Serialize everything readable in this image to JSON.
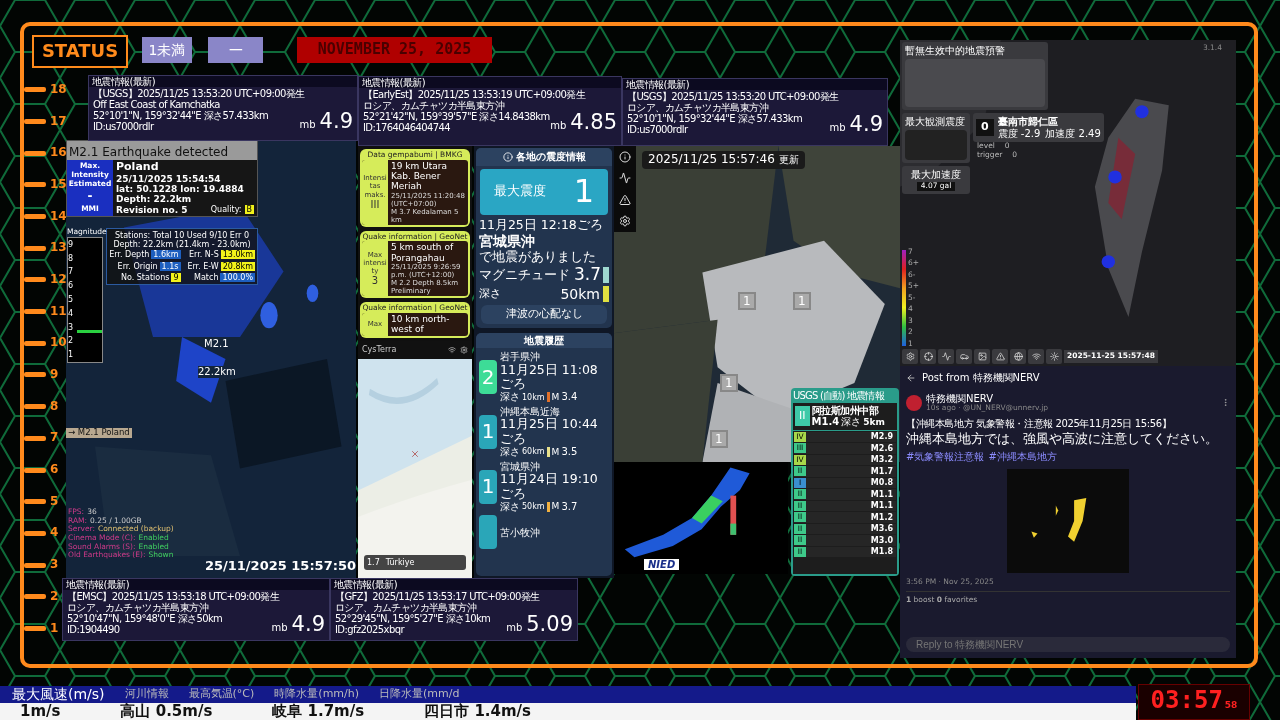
{
  "status": {
    "label": "STATUS",
    "intensity": "1未満",
    "level": "一",
    "date": "NOVEMBER 25, 2025"
  },
  "ruler": [
    "18",
    "17",
    "16",
    "15",
    "14",
    "13",
    "12",
    "11",
    "10",
    "9",
    "8",
    "7",
    "6",
    "5",
    "4",
    "3",
    "2",
    "1"
  ],
  "quake_cards": [
    {
      "header": "地震情報(最新)",
      "source": "【USGS】2025/11/25  13:53:20  UTC+09:00発生",
      "place": "Off East Coast of Kamchatka",
      "coords": "52°10'1\"N,  159°32'44\"E   深さ57.433km",
      "id": "ID:us7000rdlr",
      "unit": "mb",
      "magnitude": "4.9"
    },
    {
      "header": "地震情報(最新)",
      "source": "【EarlyEst】2025/11/25  13:53:19  UTC+09:00発生",
      "place": "ロシア、カムチャツカ半島東方沖",
      "coords": "52°21'42\"N,  159°39'57\"E   深さ14.8438km",
      "id": "ID:1764046404744",
      "unit": "mb",
      "magnitude": "4.85"
    },
    {
      "header": "地震情報(最新)",
      "source": "【USGS】2025/11/25  13:53:20  UTC+09:00発生",
      "place": "ロシア、カムチャツカ半島東方沖",
      "coords": "52°10'1\"N,  159°32'44\"E   深さ57.433km",
      "id": "ID:us7000rdlr",
      "unit": "mb",
      "magnitude": "4.9"
    },
    {
      "header": "地震情報(最新)",
      "source": "【EMSC】2025/11/25  13:53:18  UTC+09:00発生",
      "place": "ロシア、カムチャツカ半島東方沖",
      "coords": "52°10'47\"N,  159°48'0\"E   深さ50km",
      "id": "ID:1904490",
      "unit": "mb",
      "magnitude": "4.9"
    },
    {
      "header": "地震情報(最新)",
      "source": "【GFZ】2025/11/25  13:53:17  UTC+09:00発生",
      "place": "ロシア、カムチャツカ半島東方沖",
      "coords": "52°29'45\"N,  159°5'27\"E   深さ10km",
      "id": "ID:gfz2025xbqr",
      "unit": "mb",
      "magnitude": "5.09"
    }
  ],
  "globe": {
    "title": "M2.1 Earthquake detected",
    "intensity_box": [
      "Max. Intensity",
      "Estimated",
      "-",
      "MMI"
    ],
    "info": [
      "Poland",
      "25/11/2025 15:54:54",
      "lat: 50.1228 lon: 19.4884",
      "Depth: 22.2km",
      "Revision no. 5"
    ],
    "quality_label": "Quality:",
    "quality": "B",
    "stations": {
      "lines": [
        "Stations: Total 10 Used 9/10 Err 0",
        "Depth: 22.2km (21.4km - 23.0km)"
      ],
      "stats": [
        {
          "label": "Err. Depth",
          "value": "1.6km",
          "kind": "blue"
        },
        {
          "label": "Err. N-S",
          "value": "13.0km",
          "kind": "yellow"
        },
        {
          "label": "Err. Origin",
          "value": "1.1s",
          "kind": "blue"
        },
        {
          "label": "Err. E-W",
          "value": "20.8km",
          "kind": "yellow"
        },
        {
          "label": "No. Stations",
          "value": "9",
          "kind": "yellow"
        },
        {
          "label": "Match",
          "value": "100.0%",
          "kind": "blue"
        }
      ]
    },
    "magnitude_scale": {
      "label": "Magnitude",
      "ticks": [
        "9",
        "8",
        "7",
        "6",
        "5",
        "4",
        "3",
        "2",
        "1"
      ],
      "level": 0.23
    },
    "map_labels": [
      "M2.1",
      "22.2km"
    ],
    "tag": "→ M2.1 Poland",
    "diagnostics": [
      {
        "key": "FPS:",
        "value": "36"
      },
      {
        "key": "RAM:",
        "value": "0.25 / 1.00GB"
      },
      {
        "key": "Server:",
        "value": "Connected (backup)"
      },
      {
        "key": "Cinema Mode (C):",
        "value": "Enabled"
      },
      {
        "key": "Sound Alarms (S):",
        "value": "Enabled"
      },
      {
        "key": "Old Earthquakes (E):",
        "value": "Shown"
      }
    ],
    "timestamp": "25/11/2025 15:57:50"
  },
  "feed": {
    "cards": [
      {
        "header": "Data gempabumi | BMKG",
        "side": [
          "Intensitas maks.",
          "III"
        ],
        "title": "19 km Utara Kab. Bener Meriah",
        "meta": [
          "25/11/2025 11:20:48 (UTC+07:00)",
          "M 3.7   Kedalaman 5 km"
        ]
      },
      {
        "header": "Quake information | GeoNet",
        "side": [
          "Max intensity",
          "3"
        ],
        "title": "5 km south of Porangahau",
        "meta": [
          "25/11/2025 9:26:59 p.m. (UTC+12:00)",
          "M 2.2   Depth 8.5km   Preliminary"
        ]
      },
      {
        "header": "Quake information | GeoNet",
        "side": [
          "Max"
        ],
        "title": "10 km north-west of"
      }
    ],
    "app_name": "CysTerra",
    "map_card": {
      "magnitude": "1.7",
      "place": "Türkiye"
    }
  },
  "jma": {
    "header": "各地の震度情報",
    "max_label": "最大震度",
    "max_value": "1",
    "time": "11月25日 12:18ごろ",
    "place": "宮城県沖",
    "note": "で地震がありました",
    "magnitude_label": "マグニチュード",
    "magnitude": "3.7",
    "depth_label": "深さ",
    "depth": "50km",
    "tsunami": "津波の心配なし",
    "history_title": "地震履歴",
    "history": [
      {
        "intensity": "2",
        "color": "#3ddc97",
        "place": "岩手県沖",
        "time": "11月25日 11:08ごろ",
        "depth_label": "深さ",
        "depth": "10km",
        "depth_marker": {
          "color": "#e0702a"
        },
        "m": "M",
        "magnitude": "3.4"
      },
      {
        "intensity": "1",
        "color": "#2aa6b8",
        "place": "沖縄本島近海",
        "time": "11月25日 10:44ごろ",
        "depth_label": "深さ",
        "depth": "60km",
        "depth_marker": {
          "color": "#e8e08a"
        },
        "m": "M",
        "magnitude": "3.5"
      },
      {
        "intensity": "1",
        "color": "#2aa6b8",
        "place": "宮城県沖",
        "time": "11月24日 19:10ごろ",
        "depth_label": "深さ",
        "depth": "50km",
        "depth_marker": {
          "color": "#f0b040"
        },
        "m": "M",
        "magnitude": "3.7"
      },
      {
        "color": "#2aa6b8",
        "place": "苫小牧沖"
      }
    ]
  },
  "region_map": {
    "updated": "2025/11/25  15:57:46",
    "updated_label": "更新",
    "markers": [
      "1",
      "1",
      "1",
      "1"
    ]
  },
  "usgs": {
    "header": "USGS (自動) 地震情報",
    "top": {
      "intensity": "II",
      "place": "阿拉斯加州中部",
      "magnitude": "M1.4",
      "depth_label": "深さ",
      "depth": "5km"
    },
    "rows": [
      {
        "intensity": "IV",
        "color": "#a8d84a",
        "magnitude": "M2.9"
      },
      {
        "intensity": "III",
        "color": "#3ec98a",
        "magnitude": "M2.6"
      },
      {
        "intensity": "IV",
        "color": "#a8d84a",
        "magnitude": "M3.2"
      },
      {
        "intensity": "II",
        "color": "#3ec98a",
        "magnitude": "M1.7"
      },
      {
        "intensity": "I",
        "color": "#3a8fd0",
        "magnitude": "M0.8"
      },
      {
        "intensity": "II",
        "color": "#3ec98a",
        "magnitude": "M1.1"
      },
      {
        "intensity": "II",
        "color": "#3ec98a",
        "magnitude": "M1.1"
      },
      {
        "intensity": "II",
        "color": "#3ec98a",
        "magnitude": "M1.2"
      },
      {
        "intensity": "II",
        "color": "#3ec98a",
        "magnitude": "M3.6"
      },
      {
        "intensity": "II",
        "color": "#3ec98a",
        "magnitude": "M3.0"
      },
      {
        "intensity": "II",
        "color": "#3ec98a",
        "magnitude": "M1.8"
      }
    ]
  },
  "nied_logo": "NIED",
  "taiwan": {
    "warning_title": "暫無生效中的地震預警",
    "version": "3.1.4",
    "max_observed_label": "最大観測震度",
    "station_value": "0",
    "station_name": "臺南市歸仁區",
    "station_intensity": "震度 -2.9",
    "station_accel": "加速度 2.49",
    "params": [
      {
        "key": "level",
        "value": "0"
      },
      {
        "key": "trigger",
        "value": "0"
      }
    ],
    "max_accel_label": "最大加速度",
    "max_accel": "4.07 gal",
    "scale": [
      "7",
      "6+",
      "6-",
      "5+",
      "5-",
      "4",
      "3",
      "2",
      "1"
    ],
    "timestamp": "2025-11-25 15:57:48"
  },
  "post": {
    "title": "Post from 特務機関NERV",
    "author": "特務機関NERV",
    "handle": "10s ago · @UN_NERV@unnerv.jp",
    "lines": [
      "【沖縄本島地方 気象警報・注意報 2025年11月25日 15:56】",
      "沖縄本島地方では、強風や高波に注意してください。"
    ],
    "hashtags": [
      "#気象警報注意報",
      "#沖縄本島地方"
    ],
    "time": "3:56 PM · Nov 25, 2025",
    "boosts": "**1** boost  **0** favorites",
    "reply_placeholder": "Reply to 特務機関NERV"
  },
  "ticker": {
    "headings": [
      "最大風速(m/s)",
      "河川情報",
      "最高気温(°C)",
      "時降水量(mm/h)",
      "日降水量(mm/d"
    ],
    "values": [
      "1m/s",
      "高山 0.5m/s",
      "岐阜 1.7m/s",
      "四日市 1.4m/s"
    ]
  },
  "clock": {
    "time": "03:57",
    "seconds": "58"
  }
}
